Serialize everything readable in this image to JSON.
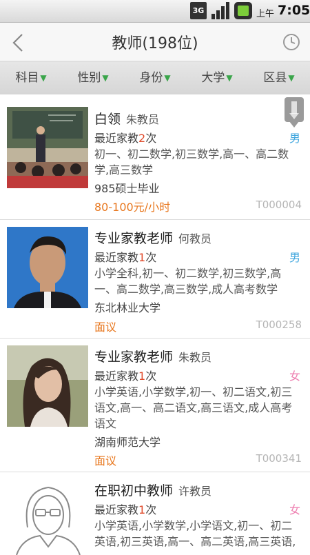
{
  "statusbar": {
    "network": "3G",
    "ampm": "上午",
    "time": "7:05"
  },
  "header": {
    "title": "教师(198位)"
  },
  "filters": [
    {
      "label": "科目"
    },
    {
      "label": "性别"
    },
    {
      "label": "身份"
    },
    {
      "label": "大学"
    },
    {
      "label": "区县"
    }
  ],
  "teachers": [
    {
      "title": "白领",
      "teacher": "朱教员",
      "recent_prefix": "最近家教",
      "recent_count": "2",
      "recent_suffix": "次",
      "gender": "男",
      "subjects": "初一、初二数学,初三数学,高一、高二数学,高三数学",
      "school": "985硕士毕业",
      "price": "80-100元/小时",
      "code": "T000004"
    },
    {
      "title": "专业家教老师",
      "teacher": "何教员",
      "recent_prefix": "最近家教",
      "recent_count": "1",
      "recent_suffix": "次",
      "gender": "男",
      "subjects": "小学全科,初一、初二数学,初三数学,高一、高二数学,高三数学,成人高考数学",
      "school": "东北林业大学",
      "price": "面议",
      "code": "T000258"
    },
    {
      "title": "专业家教老师",
      "teacher": "朱教员",
      "recent_prefix": "最近家教",
      "recent_count": "1",
      "recent_suffix": "次",
      "gender": "女",
      "subjects": "小学英语,小学数学,初一、初二语文,初三语文,高一、高二语文,高三语文,成人高考语文",
      "school": "湖南师范大学",
      "price": "面议",
      "code": "T000341"
    },
    {
      "title": "在职初中教师",
      "teacher": "许教员",
      "recent_prefix": "最近家教",
      "recent_count": "1",
      "recent_suffix": "次",
      "gender": "女",
      "subjects": "小学英语,小学数学,小学语文,初一、初二英语,初三英语,高一、高二英语,高三英语,成人高考英语"
    }
  ],
  "colors": {
    "accent_green": "#3aa54a",
    "price_orange": "#e8771e",
    "male_blue": "#3fa6de",
    "female_pink": "#ee7fb0",
    "count_red": "#e04a2a"
  }
}
